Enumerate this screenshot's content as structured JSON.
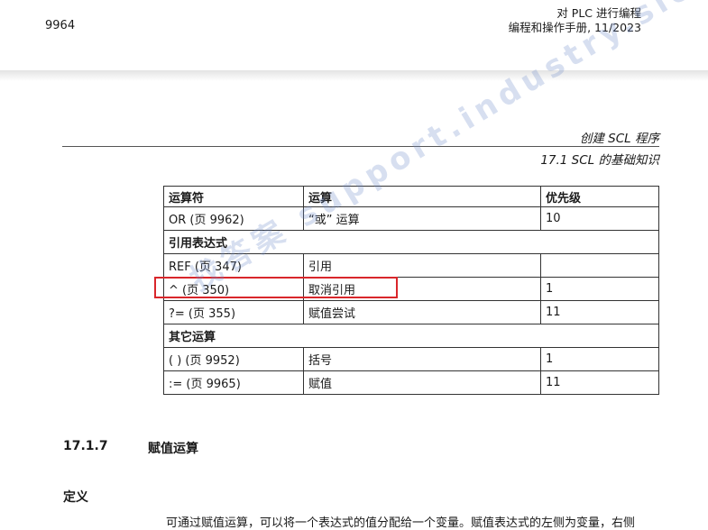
{
  "header": {
    "page_number": "9964",
    "line1": "对 PLC 进行编程",
    "line2": "编程和操作手册, 11/2023"
  },
  "chapter_title": "创建 SCL 程序",
  "section_title": "17.1 SCL 的基础知识",
  "table": {
    "headers": [
      "运算符",
      "运算",
      "优先级"
    ],
    "rows": [
      {
        "type": "data",
        "cells": [
          "OR (页 9962)",
          "“或” 运算",
          "10"
        ]
      },
      {
        "type": "group",
        "cells": [
          "引用表达式"
        ]
      },
      {
        "type": "data",
        "cells": [
          "REF (页 347)",
          "引用",
          ""
        ]
      },
      {
        "type": "data",
        "cells": [
          "^ (页 350)",
          "取消引用",
          "1"
        ]
      },
      {
        "type": "data",
        "cells": [
          "?= (页 355)",
          "赋值尝试",
          "11"
        ]
      },
      {
        "type": "group",
        "cells": [
          "其它运算"
        ]
      },
      {
        "type": "data",
        "cells": [
          "( ) (页 9952)",
          "括号",
          "1"
        ]
      },
      {
        "type": "data",
        "cells": [
          ":= (页 9965)",
          "赋值",
          "11"
        ]
      }
    ]
  },
  "watermark": "找答案 support.industry.siemens.com/cs 西门子工业",
  "heading_number": "17.1.7",
  "heading_text": "赋值运算",
  "subheading": "定义",
  "body_text": "可通过赋值运算，可以将一个表达式的值分配给一个变量。赋值表达式的左侧为变量，右侧",
  "colors": {
    "highlight": "#d9262b"
  }
}
